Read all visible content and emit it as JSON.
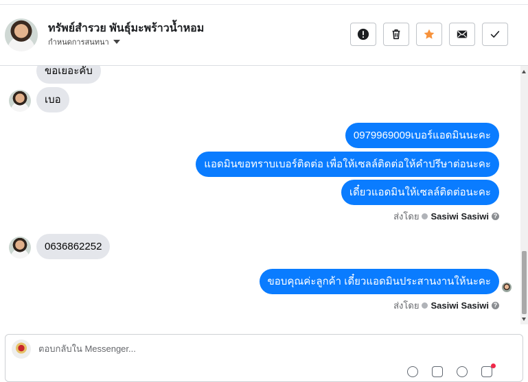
{
  "header": {
    "contact_name": "ทรัพย์สำรวย พันธุ์มะพร้าวน้ำหอม",
    "assign_label": "กำหนดการสนทนา",
    "actions": [
      {
        "name": "spam-button",
        "icon": "exclamation-icon"
      },
      {
        "name": "delete-button",
        "icon": "trash-icon"
      },
      {
        "name": "star-button",
        "icon": "star-icon",
        "color": "#f7923b"
      },
      {
        "name": "mark-unread-button",
        "icon": "envelope-icon"
      },
      {
        "name": "mark-done-button",
        "icon": "check-icon"
      }
    ]
  },
  "messages": [
    {
      "direction": "incoming",
      "text": "ขอเยอะคับ"
    },
    {
      "direction": "incoming",
      "text": "เบอ"
    },
    {
      "direction": "outgoing",
      "text": "0979969009เบอร์แอดมินนะคะ"
    },
    {
      "direction": "outgoing",
      "text": "แอดมินขอทราบเบอร์ติดต่อ เพื่อให้เซลล์ติดต่อให้คำปรึษาต่อนะคะ"
    },
    {
      "direction": "outgoing",
      "text": "เดี๋ยวแอดมินให้เซลล์ติดต่อนะคะ"
    },
    {
      "direction": "incoming",
      "text": "0636862252"
    },
    {
      "direction": "outgoing",
      "text": "ขอบคุณค่ะลูกค้า เดี๋ยวแอดมินประสานงานให้นะคะ"
    }
  ],
  "sent_by": {
    "prefix": "ส่งโดย",
    "name": "Sasiwi Sasiwi",
    "help": "?"
  },
  "reply": {
    "placeholder": "ตอบกลับใน Messenger..."
  },
  "colors": {
    "outgoing_bubble": "#0a7cff",
    "incoming_bubble": "#e4e6eb",
    "star": "#f7923b"
  }
}
